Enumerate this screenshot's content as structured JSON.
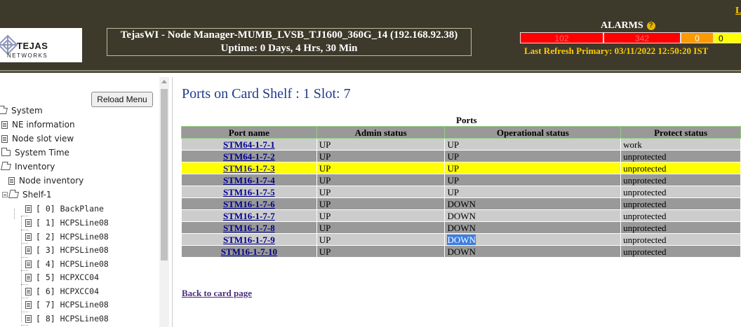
{
  "header": {
    "logo_text": "TEJAS",
    "logo_subtext": "NETWORKS",
    "title": "TejasWI - Node Manager-MUMB_LVSB_TJ1600_360G_14 (192.168.92.38)",
    "uptime": "Uptime: 0 Days, 4 Hrs, 30 Min",
    "corner_link": "L",
    "alarms": {
      "title": "ALARMS",
      "help_icon": "?",
      "critical": "102",
      "major": "342",
      "minor": "0",
      "warning": "0",
      "colors": {
        "critical": "#ff0000",
        "major": "#ff0000",
        "minor": "#ff9900",
        "warning": "#ffff00"
      }
    },
    "last_refresh": "Last Refresh Primary: 03/11/2022 12:50:20 IST"
  },
  "sidebar": {
    "reload_label": "Reload Menu",
    "tree": [
      {
        "label": "System",
        "icon": "folder-open-icon"
      },
      {
        "label": "NE information",
        "icon": "doc-icon"
      },
      {
        "label": "Node slot view",
        "icon": "doc-icon"
      },
      {
        "label": "System Time",
        "icon": "folder-icon"
      },
      {
        "label": "Inventory",
        "icon": "folder-open-icon"
      },
      {
        "label": "Node inventory",
        "icon": "doc-icon"
      },
      {
        "label": "Shelf-1",
        "icon": "folder-open-icon"
      },
      {
        "label": "[ 0] BackPlane",
        "icon": "doc-icon"
      },
      {
        "label": "[ 1] HCPSLine08",
        "icon": "doc-icon"
      },
      {
        "label": "[ 2] HCPSLine08",
        "icon": "doc-icon"
      },
      {
        "label": "[ 3] HCPSLine08",
        "icon": "doc-icon"
      },
      {
        "label": "[ 4] HCPSLine08",
        "icon": "doc-icon"
      },
      {
        "label": "[ 5] HCPXCC04",
        "icon": "doc-icon"
      },
      {
        "label": "[ 6] HCPXCC04",
        "icon": "doc-icon"
      },
      {
        "label": "[ 7] HCPSLine08",
        "icon": "doc-icon"
      },
      {
        "label": "[ 8] HCPSLine08",
        "icon": "doc-icon"
      }
    ]
  },
  "main": {
    "page_title": "Ports on Card Shelf : 1 Slot: 7",
    "table_caption": "Ports",
    "columns": [
      "Port name",
      "Admin status",
      "Operational status",
      "Protect status"
    ],
    "rows": [
      {
        "port": "STM64-1-7-1",
        "admin": "UP",
        "oper": "UP",
        "protect": "work"
      },
      {
        "port": "STM64-1-7-2",
        "admin": "UP",
        "oper": "UP",
        "protect": "unprotected"
      },
      {
        "port": "STM16-1-7-3",
        "admin": "UP",
        "oper": "UP",
        "protect": "unprotected"
      },
      {
        "port": "STM16-1-7-4",
        "admin": "UP",
        "oper": "UP",
        "protect": "unprotected"
      },
      {
        "port": "STM16-1-7-5",
        "admin": "UP",
        "oper": "UP",
        "protect": "unprotected"
      },
      {
        "port": "STM16-1-7-6",
        "admin": "UP",
        "oper": "DOWN",
        "protect": "unprotected"
      },
      {
        "port": "STM16-1-7-7",
        "admin": "UP",
        "oper": "DOWN",
        "protect": "unprotected"
      },
      {
        "port": "STM16-1-7-8",
        "admin": "UP",
        "oper": "DOWN",
        "protect": "unprotected"
      },
      {
        "port": "STM16-1-7-9",
        "admin": "UP",
        "oper": "DOWN",
        "protect": "unprotected"
      },
      {
        "port": "STM16-1-7-10",
        "admin": "UP",
        "oper": "DOWN",
        "protect": "unprotected"
      }
    ],
    "highlight_color": "#ffff00",
    "back_link": "Back to card page"
  }
}
